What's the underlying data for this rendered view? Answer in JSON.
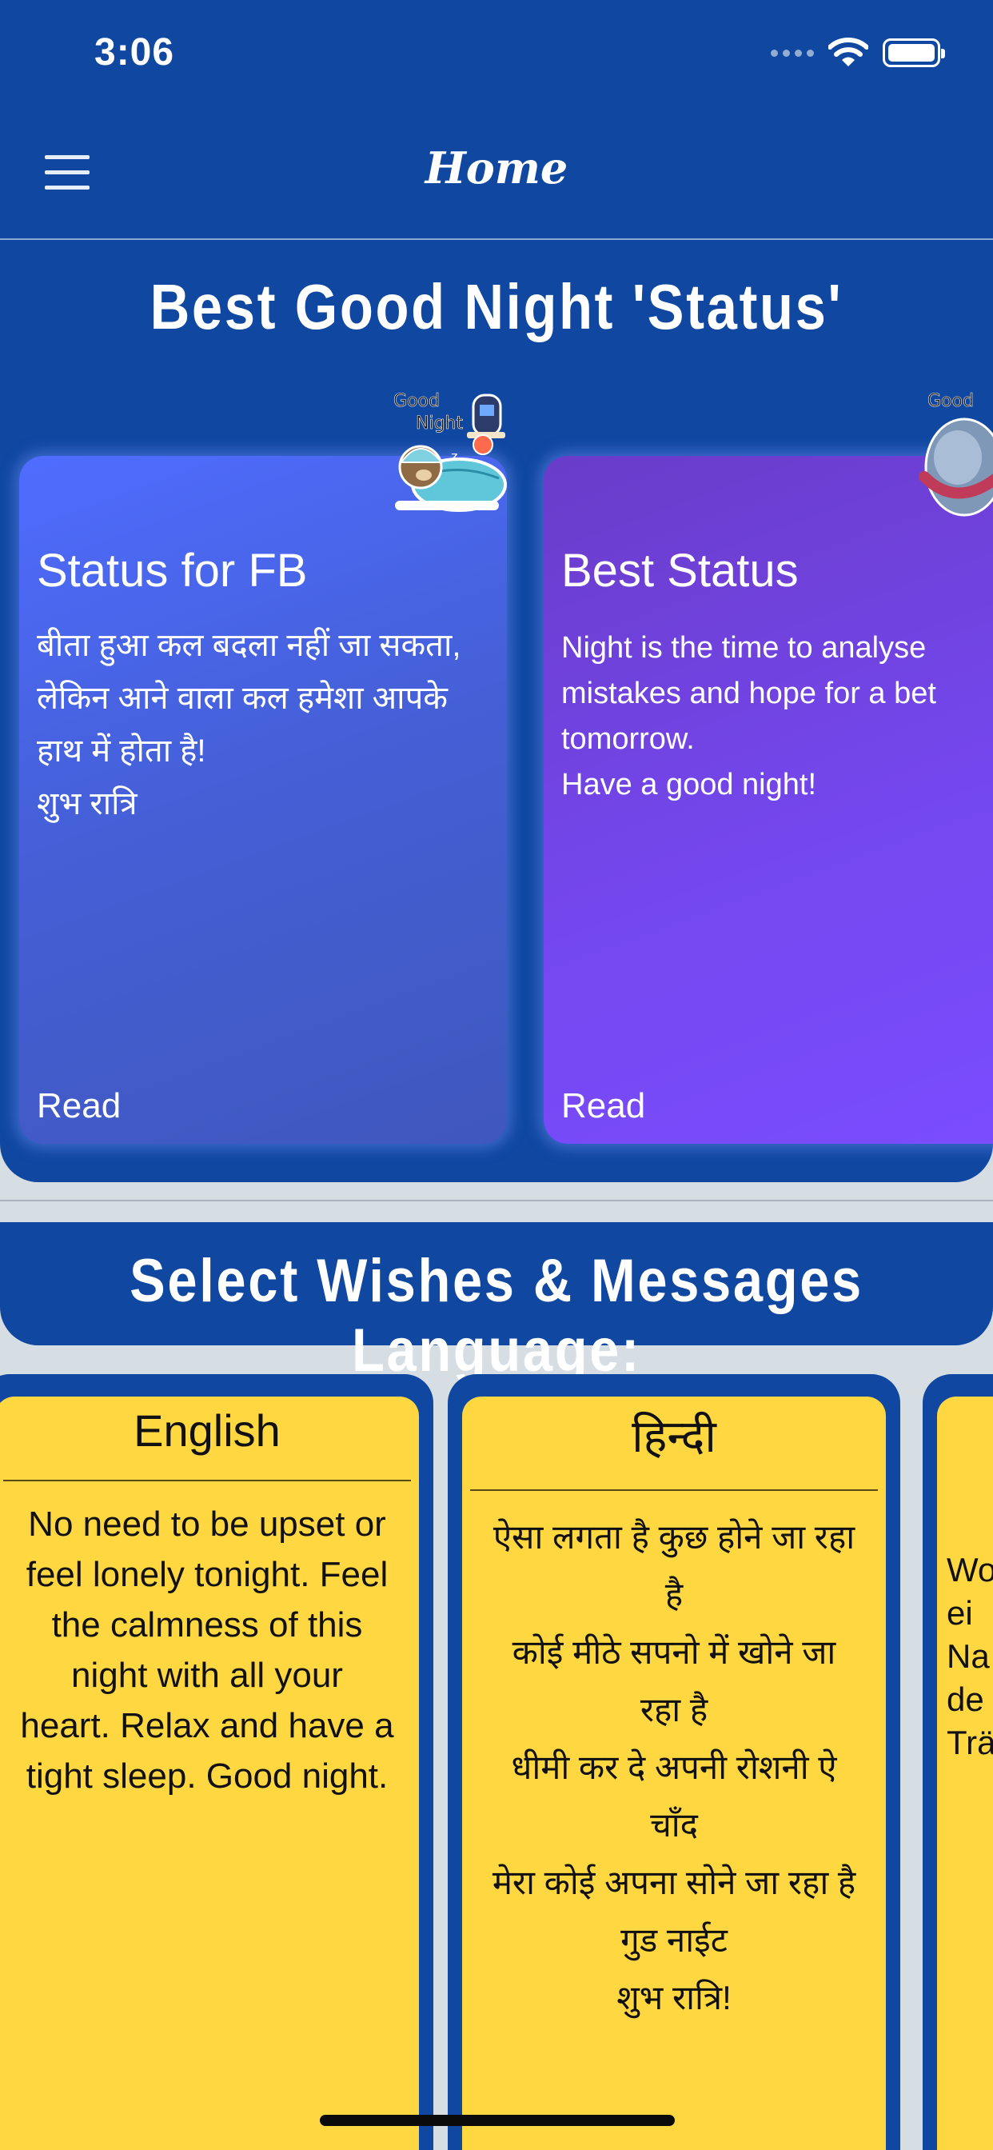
{
  "status_bar": {
    "time": "3:06"
  },
  "nav": {
    "title": "Home"
  },
  "status_section": {
    "title": "Best Good Night 'Status'",
    "cards": [
      {
        "title": "Status for FB",
        "text": "बीता हुआ कल बदला नहीं जा सकता,\nलेकिन आने वाला कल हमेशा आपके\nहाथ में होता है!\nशुभ रात्रि",
        "read_label": "Read",
        "sticker_text": [
          "Good",
          "Night"
        ],
        "sticker_sleep": "z"
      },
      {
        "title": "Best Status",
        "text": "Night is the time to analyse\nmistakes and hope for a bet\ntomorrow.\nHave a good night!",
        "read_label": "Read",
        "sticker_text": "Good"
      }
    ]
  },
  "language_section": {
    "title": "Select Wishes & Messages Language:",
    "cards": [
      {
        "name": "English",
        "text": "No need to be upset or\nfeel lonely tonight. Feel\nthe calmness of this\nnight with all your\nheart. Relax and have a\ntight sleep. Good night."
      },
      {
        "name": "हिन्दी",
        "text": "ऐसा लगता है कुछ होने जा रहा\nहै\nकोई मीठे सपनो में खोने जा\nरहा है\nधीमी कर दे अपनी रोशनी ऐ\nचाँद\nमेरा कोई अपना सोने जा रहा है\nगुड नाईट\nशुभ रात्रि!"
      },
      {
        "name": "",
        "text": "Wo\nei\nNa\nde\nTrä"
      }
    ]
  },
  "colors": {
    "primary_blue": "#0f47a1",
    "card_blue": "#4f6cff",
    "card_purple": "#7447ee",
    "language_card_yellow": "#ffd740"
  }
}
